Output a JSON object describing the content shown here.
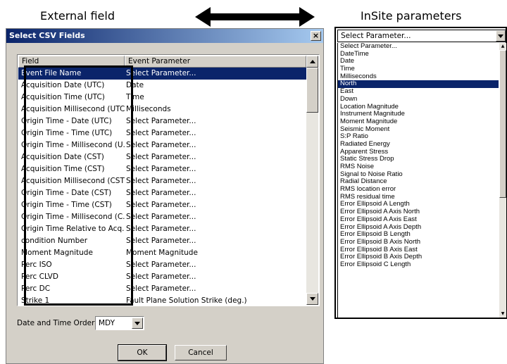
{
  "captions": {
    "left": "External field",
    "right": "InSite parameters"
  },
  "dialog": {
    "title": "Select CSV Fields",
    "close_label": "×",
    "columns": [
      "Field",
      "Event Parameter"
    ],
    "rows": [
      {
        "field": "Event File Name",
        "param": "Select Parameter..."
      },
      {
        "field": "Acquisition Date (UTC)",
        "param": "Date"
      },
      {
        "field": "Acquisition Time (UTC)",
        "param": "Time"
      },
      {
        "field": "Acquisition Millisecond (UTC)",
        "param": "Milliseconds"
      },
      {
        "field": "Origin Time - Date (UTC)",
        "param": "Select Parameter..."
      },
      {
        "field": "Origin Time - Time (UTC)",
        "param": "Select Parameter..."
      },
      {
        "field": "Origin Time - Millisecond (U...",
        "param": "Select Parameter..."
      },
      {
        "field": "Acquisition Date (CST)",
        "param": "Select Parameter..."
      },
      {
        "field": "Acquisition Time (CST)",
        "param": "Select Parameter..."
      },
      {
        "field": "Acquisition Millisecond (CST)",
        "param": "Select Parameter..."
      },
      {
        "field": "Origin Time - Date (CST)",
        "param": "Select Parameter..."
      },
      {
        "field": "Origin Time - Time (CST)",
        "param": "Select Parameter..."
      },
      {
        "field": "Origin Time - Millisecond (C...",
        "param": "Select Parameter..."
      },
      {
        "field": "Origin Time Relative to Acq...",
        "param": "Select Parameter..."
      },
      {
        "field": "condition Number",
        "param": "Select Parameter..."
      },
      {
        "field": "Moment Magnitude",
        "param": "Moment Magnitude"
      },
      {
        "field": "Perc ISO",
        "param": "Select Parameter..."
      },
      {
        "field": "Perc CLVD",
        "param": "Select Parameter..."
      },
      {
        "field": "Perc DC",
        "param": "Select Parameter..."
      },
      {
        "field": "Strike 1",
        "param": "Fault Plane Solution Strike (deg.)"
      }
    ],
    "selected_row": 0,
    "date_order_label": "Date and Time Order:",
    "date_order_value": "MDY",
    "ok_label": "OK",
    "cancel_label": "Cancel"
  },
  "param_dropdown": {
    "selected_value": "Select Parameter...",
    "highlighted_item": 5,
    "items": [
      "Select Parameter...",
      "DateTime",
      "Date",
      "Time",
      "Milliseconds",
      "North",
      "East",
      "Down",
      "Location Magnitude",
      "Instrument Magnitude",
      "Moment Magnitude",
      "Seismic Moment",
      "S:P Ratio",
      "Radiated Energy",
      "Apparent Stress",
      "Static Stress Drop",
      "RMS Noise",
      "Signal to Noise Ratio",
      "Radial Distance",
      "RMS location error",
      "RMS residual time",
      "Error Ellipsoid A Length",
      "Error Ellipsoid A Axis North",
      "Error Ellipsoid A Axis East",
      "Error Ellipsoid A Axis Depth",
      "Error Ellipsoid B Length",
      "Error Ellipsoid B Axis North",
      "Error Ellipsoid B Axis East",
      "Error Ellipsoid B Axis Depth",
      "Error Ellipsoid C Length"
    ]
  }
}
